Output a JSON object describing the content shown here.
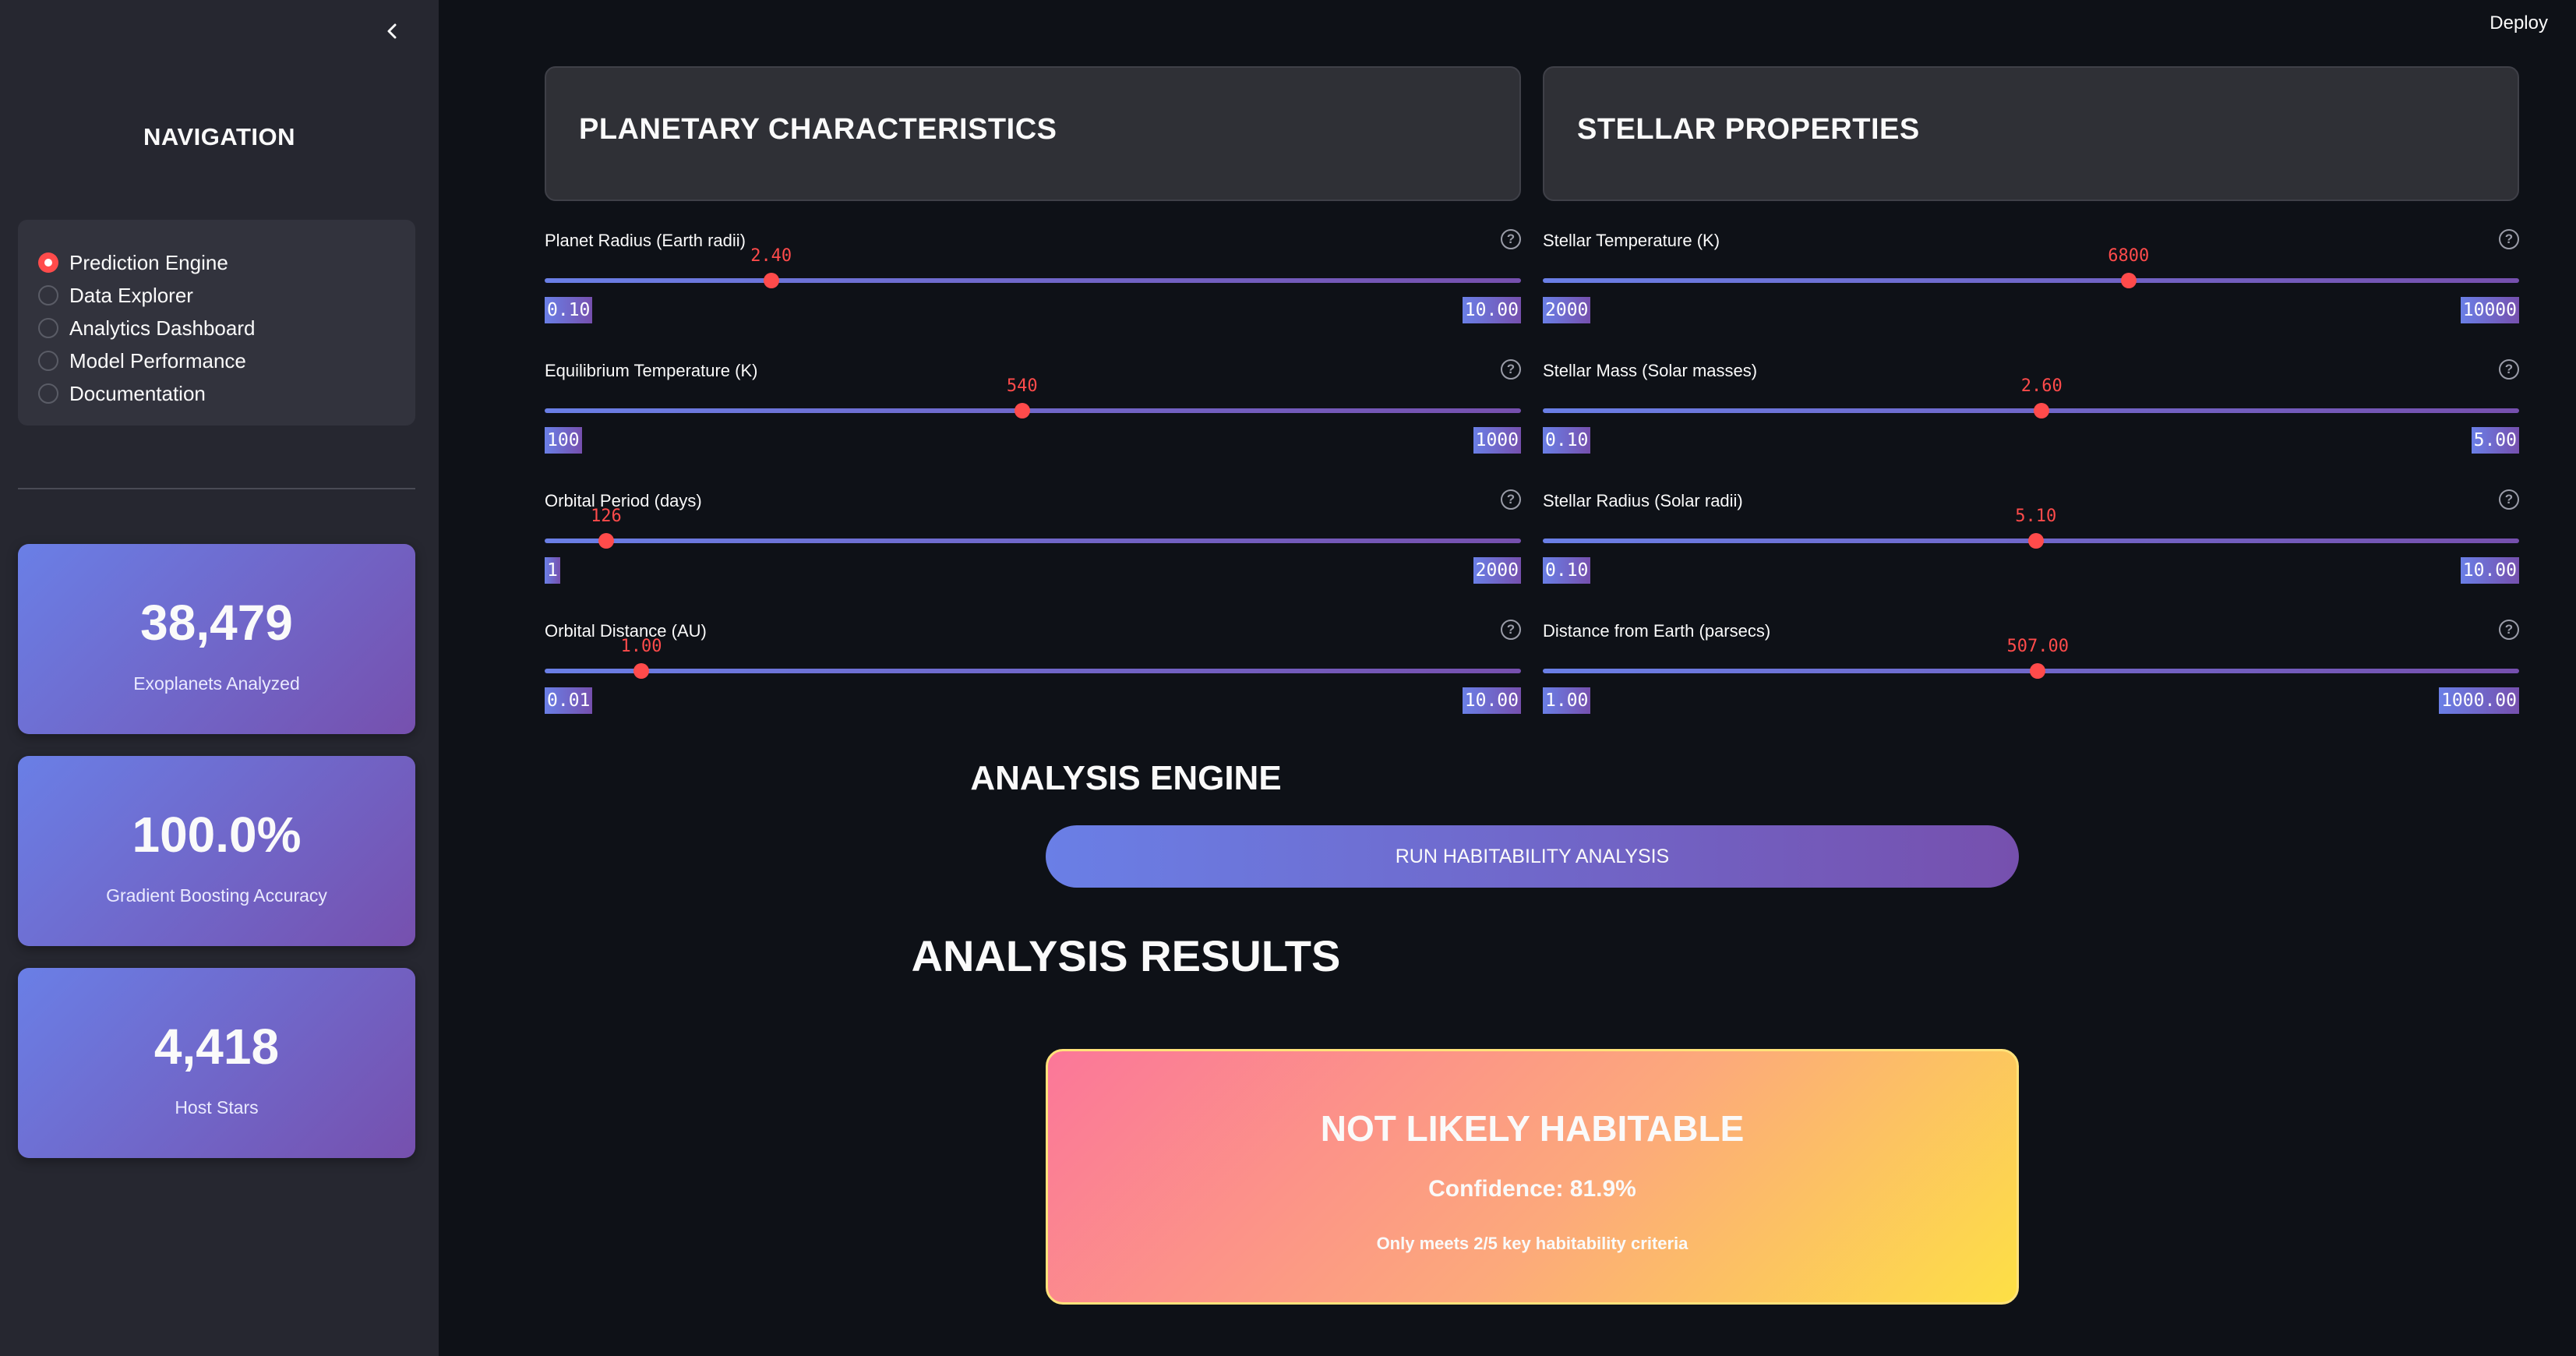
{
  "header": {
    "deploy_label": "Deploy"
  },
  "sidebar": {
    "nav_title": "NAVIGATION",
    "nav_items": [
      {
        "label": "Prediction Engine",
        "selected": true
      },
      {
        "label": "Data Explorer",
        "selected": false
      },
      {
        "label": "Analytics Dashboard",
        "selected": false
      },
      {
        "label": "Model Performance",
        "selected": false
      },
      {
        "label": "Documentation",
        "selected": false
      }
    ],
    "stats": [
      {
        "value": "38,479",
        "label": "Exoplanets Analyzed"
      },
      {
        "value": "100.0%",
        "label": "Gradient Boosting Accuracy"
      },
      {
        "value": "4,418",
        "label": "Host Stars"
      }
    ]
  },
  "sections": {
    "planetary": "PLANETARY CHARACTERISTICS",
    "stellar": "STELLAR PROPERTIES"
  },
  "planetary_sliders": [
    {
      "label": "Planet Radius (Earth radii)",
      "value": "2.40",
      "min": "0.10",
      "max": "10.00"
    },
    {
      "label": "Equilibrium Temperature (K)",
      "value": "540",
      "min": "100",
      "max": "1000"
    },
    {
      "label": "Orbital Period (days)",
      "value": "126",
      "min": "1",
      "max": "2000"
    },
    {
      "label": "Orbital Distance (AU)",
      "value": "1.00",
      "min": "0.01",
      "max": "10.00"
    }
  ],
  "stellar_sliders": [
    {
      "label": "Stellar Temperature (K)",
      "value": "6800",
      "min": "2000",
      "max": "10000"
    },
    {
      "label": "Stellar Mass (Solar masses)",
      "value": "2.60",
      "min": "0.10",
      "max": "5.00"
    },
    {
      "label": "Stellar Radius (Solar radii)",
      "value": "5.10",
      "min": "0.10",
      "max": "10.00"
    },
    {
      "label": "Distance from Earth (parsecs)",
      "value": "507.00",
      "min": "1.00",
      "max": "1000.00"
    }
  ],
  "engine": {
    "title": "ANALYSIS ENGINE",
    "run_label": "RUN HABITABILITY ANALYSIS"
  },
  "results": {
    "title": "ANALYSIS RESULTS",
    "verdict": "NOT LIKELY HABITABLE",
    "confidence": "Confidence: 81.9%",
    "criteria": "Only meets 2/5 key habitability criteria"
  },
  "colors": {
    "accent": "#ff4b4b",
    "gradient_start": "#6a7fe6",
    "gradient_end": "#7650ae",
    "background": "#0e1117",
    "sidebar": "#262730"
  }
}
